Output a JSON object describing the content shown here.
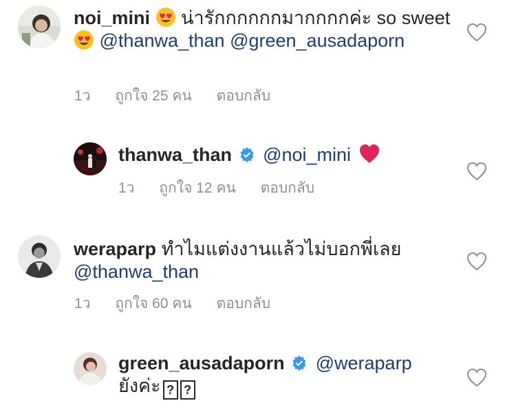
{
  "comments": [
    {
      "username": "noi_mini",
      "text_part1": "น่ารักกกกกกมากกกกค่ะ so",
      "text_part2": "sweet",
      "mention1": "@thanwa_than",
      "mention2": "@green_ausadaporn",
      "time": "1ว",
      "likes": "ถูกใจ 25 คน",
      "reply": "ตอบกลับ"
    },
    {
      "username": "thanwa_than",
      "mention": "@noi_mini",
      "time": "1ว",
      "likes": "ถูกใจ 12 คน",
      "reply": "ตอบกลับ"
    },
    {
      "username": "weraparp",
      "text": "ทำไมแต่งงานแล้วไม่บอกพี่เลย",
      "mention": "@thanwa_than",
      "time": "1ว",
      "likes": "ถูกใจ 60 คน",
      "reply": "ตอบกลับ"
    },
    {
      "username": "green_ausadaporn",
      "mention": "@weraparp",
      "text": "ยังค่ะ",
      "box1": "?",
      "box2": "?"
    }
  ],
  "colors": {
    "text": "#262626",
    "mention": "#1c3e73",
    "meta": "#8e8e8e",
    "verified": "#3897f0",
    "heart_emoji": "#e0245e"
  },
  "icons": {
    "like": "heart-outline-icon",
    "verified": "verified-badge-icon",
    "emoji_heart_eyes": "heart-eyes-emoji",
    "emoji_red_heart": "red-heart-emoji"
  }
}
